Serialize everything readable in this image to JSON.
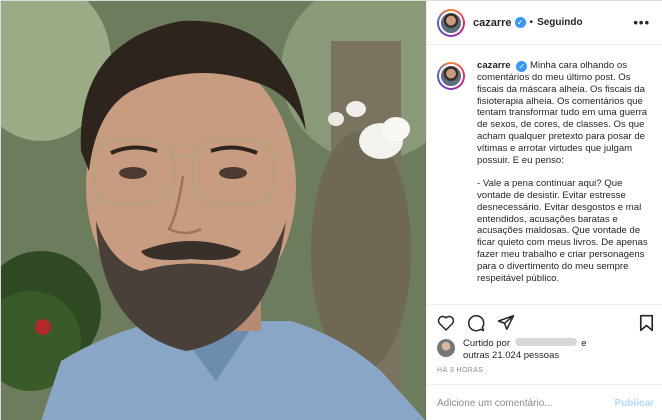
{
  "header": {
    "username": "cazarre",
    "dot": "•",
    "follow_state": "Seguindo",
    "more": "•••"
  },
  "caption": {
    "username": "cazarre",
    "paragraph1": "Minha cara olhando os comentários do meu último post. Os fiscais da máscara alheia. Os fiscais da fisioterapia alheia. Os comentários que tentam transformar tudo em uma guerra de sexos, de cores, de classes. Os que acham qualquer pretexto para posar de vítimas e arrotar virtudes que julgam possuir. E eu penso:",
    "paragraph2": "- Vale a pena continuar aqui? Que vontade de desistir. Evitar estresse desnecessário. Evitar desgostos e mal entendidos, acusações baratas e acusações maldosas. Que vontade de ficar quieto com meus livros. De apenas fazer meu trabalho e criar personagens para o divertimento do meu sempre respeitável público."
  },
  "likes": {
    "prefix": "Curtido por",
    "connector": "e",
    "others": "outras 21.024 pessoas"
  },
  "time": "HÁ 3 HORAS",
  "comment": {
    "placeholder": "Adicione um comentário...",
    "publish": "Publicar"
  },
  "icons": [
    "heart-icon",
    "comment-icon",
    "share-icon",
    "bookmark-icon",
    "verified-badge-icon",
    "more-options-icon"
  ],
  "colors": {
    "verified": "#3897f0",
    "publish": "#b3dbff",
    "border": "#dbdbdb",
    "muted": "#8e8e8e"
  }
}
